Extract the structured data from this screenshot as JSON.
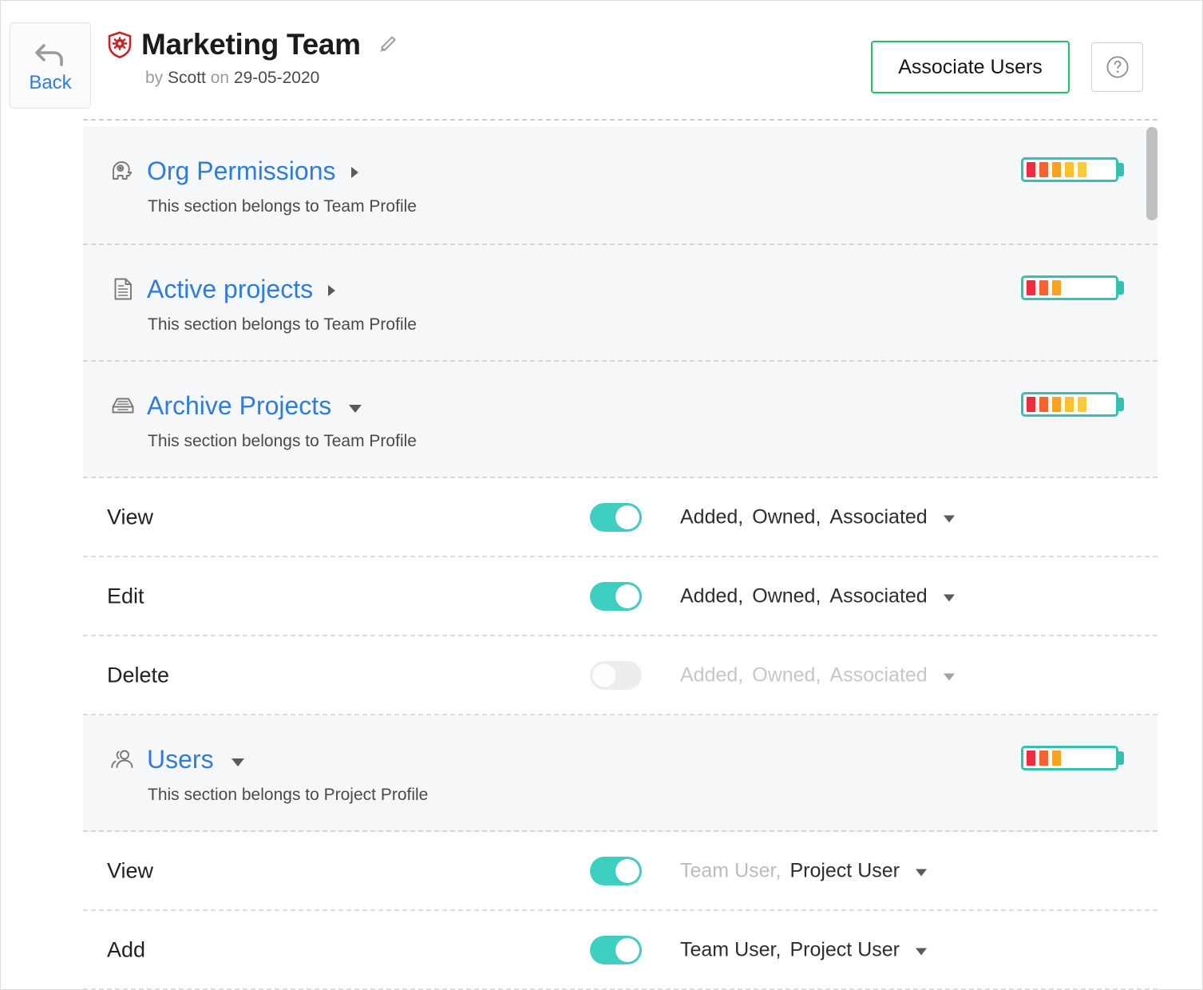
{
  "header": {
    "back_label": "Back",
    "title": "Marketing Team",
    "byline_by": "by ",
    "byline_author": "Scott",
    "byline_on": " on ",
    "byline_date": "29-05-2020",
    "associate_users_label": "Associate Users",
    "shield_icon": "shield-gear-icon",
    "pencil_icon": "pencil-edit-icon",
    "help_icon": "question-mark-icon",
    "back_icon": "back-arrow-icon",
    "accent_green": "#22c06a",
    "link_blue": "#2f7ddb",
    "shield_red": "#cb2026"
  },
  "meter": {
    "border_color": "#35c1b2",
    "bar_colors": [
      "#ef2b42",
      "#f4622f",
      "#f7a021",
      "#fbc02d",
      "#fcc93c"
    ]
  },
  "sections": [
    {
      "title": "Org Permissions",
      "subtitle": "This section belongs to Team Profile",
      "icon": "head-gear-permissions-icon",
      "expanded": false,
      "meter_bars": 5
    },
    {
      "title": "Active projects",
      "subtitle": "This section belongs to Team Profile",
      "icon": "document-icon",
      "expanded": false,
      "meter_bars": 3
    },
    {
      "title": "Archive Projects",
      "subtitle": "This section belongs to Team Profile",
      "icon": "archive-tray-icon",
      "expanded": true,
      "meter_bars": 5
    },
    {
      "title": "Users",
      "subtitle": "This section belongs to Project Profile",
      "icon": "users-group-icon",
      "expanded": true,
      "meter_bars": 3
    }
  ],
  "archive_permissions": [
    {
      "label": "View",
      "enabled": true,
      "tokens": [
        {
          "text": "Added,",
          "dim": false
        },
        {
          "text": "Owned,",
          "dim": false
        },
        {
          "text": "Associated",
          "dim": false
        }
      ]
    },
    {
      "label": "Edit",
      "enabled": true,
      "tokens": [
        {
          "text": "Added,",
          "dim": false
        },
        {
          "text": "Owned,",
          "dim": false
        },
        {
          "text": "Associated",
          "dim": false
        }
      ]
    },
    {
      "label": "Delete",
      "enabled": false,
      "tokens": [
        {
          "text": "Added,",
          "dim": true
        },
        {
          "text": "Owned,",
          "dim": true
        },
        {
          "text": "Associated",
          "dim": true
        }
      ]
    }
  ],
  "users_permissions": [
    {
      "label": "View",
      "enabled": true,
      "tokens": [
        {
          "text": "Team User,",
          "dim": true
        },
        {
          "text": "Project User",
          "dim": false
        }
      ]
    },
    {
      "label": "Add",
      "enabled": true,
      "tokens": [
        {
          "text": "Team User,",
          "dim": false
        },
        {
          "text": "Project User",
          "dim": false
        }
      ]
    }
  ]
}
